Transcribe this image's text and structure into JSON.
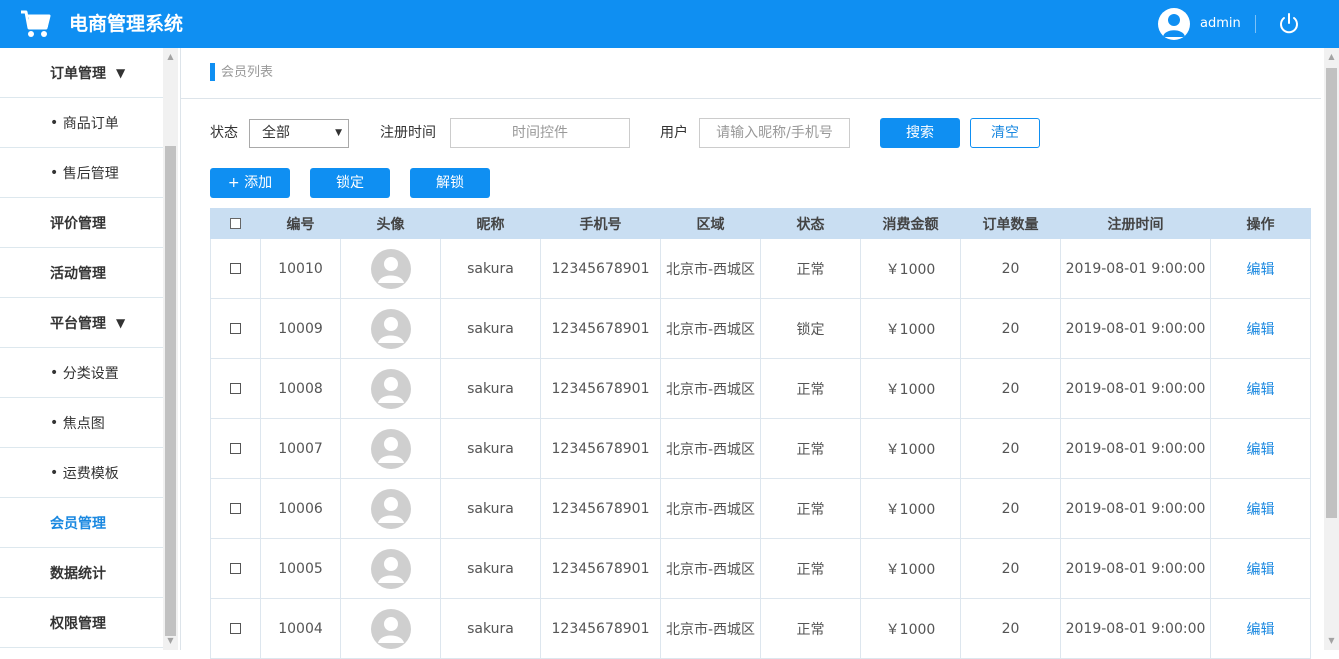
{
  "header": {
    "title": "电商管理系统",
    "username": "admin",
    "color": "#0f8ff2"
  },
  "sidebar": {
    "items": [
      {
        "label": "订单管理",
        "type": "group",
        "expanded": true
      },
      {
        "label": "商品订单",
        "type": "sub"
      },
      {
        "label": "售后管理",
        "type": "sub"
      },
      {
        "label": "评价管理",
        "type": "group"
      },
      {
        "label": "活动管理",
        "type": "group"
      },
      {
        "label": "平台管理",
        "type": "group",
        "expanded": true
      },
      {
        "label": "分类设置",
        "type": "sub"
      },
      {
        "label": "焦点图",
        "type": "sub"
      },
      {
        "label": "运费模板",
        "type": "sub"
      },
      {
        "label": "会员管理",
        "type": "group",
        "active": true
      },
      {
        "label": "数据统计",
        "type": "group"
      },
      {
        "label": "权限管理",
        "type": "group"
      }
    ],
    "caret": "▼",
    "bullet": "•"
  },
  "breadcrumb": {
    "text": "会员列表"
  },
  "filters": {
    "status_label": "状态",
    "status_value": "全部",
    "regtime_label": "注册时间",
    "regtime_placeholder": "时间控件",
    "user_label": "用户",
    "user_placeholder": "请输入昵称/手机号",
    "search_button": "搜索",
    "clear_button": "清空"
  },
  "actions": {
    "add": "+ 添加",
    "lock": "锁定",
    "unlock": "解锁"
  },
  "table": {
    "columns": [
      "编号",
      "头像",
      "昵称",
      "手机号",
      "区域",
      "状态",
      "消费金额",
      "订单数量",
      "注册时间",
      "操作"
    ],
    "rows": [
      {
        "id": "10010",
        "nickname": "sakura",
        "phone": "12345678901",
        "region": "北京市-西城区",
        "status": "正常",
        "amount": "￥1000",
        "orders": "20",
        "regtime": "2019-08-01 9:00:00",
        "action": "编辑"
      },
      {
        "id": "10009",
        "nickname": "sakura",
        "phone": "12345678901",
        "region": "北京市-西城区",
        "status": "锁定",
        "amount": "￥1000",
        "orders": "20",
        "regtime": "2019-08-01 9:00:00",
        "action": "编辑"
      },
      {
        "id": "10008",
        "nickname": "sakura",
        "phone": "12345678901",
        "region": "北京市-西城区",
        "status": "正常",
        "amount": "￥1000",
        "orders": "20",
        "regtime": "2019-08-01 9:00:00",
        "action": "编辑"
      },
      {
        "id": "10007",
        "nickname": "sakura",
        "phone": "12345678901",
        "region": "北京市-西城区",
        "status": "正常",
        "amount": "￥1000",
        "orders": "20",
        "regtime": "2019-08-01 9:00:00",
        "action": "编辑"
      },
      {
        "id": "10006",
        "nickname": "sakura",
        "phone": "12345678901",
        "region": "北京市-西城区",
        "status": "正常",
        "amount": "￥1000",
        "orders": "20",
        "regtime": "2019-08-01 9:00:00",
        "action": "编辑"
      },
      {
        "id": "10005",
        "nickname": "sakura",
        "phone": "12345678901",
        "region": "北京市-西城区",
        "status": "正常",
        "amount": "￥1000",
        "orders": "20",
        "regtime": "2019-08-01 9:00:00",
        "action": "编辑"
      },
      {
        "id": "10004",
        "nickname": "sakura",
        "phone": "12345678901",
        "region": "北京市-西城区",
        "status": "正常",
        "amount": "￥1000",
        "orders": "20",
        "regtime": "2019-08-01 9:00:00",
        "action": "编辑"
      }
    ]
  }
}
